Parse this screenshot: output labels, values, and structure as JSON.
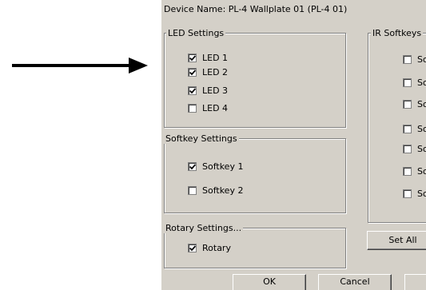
{
  "dialog": {
    "device_name": "Device Name: PL-4 Wallplate 01 (PL-4 01)"
  },
  "led_settings": {
    "legend": "LED Settings",
    "items": [
      {
        "label": "LED 1",
        "checked": true
      },
      {
        "label": "LED 2",
        "checked": true
      },
      {
        "label": "LED 3",
        "checked": true
      },
      {
        "label": "LED 4",
        "checked": false
      }
    ]
  },
  "softkey_settings": {
    "legend": "Softkey Settings",
    "items": [
      {
        "label": "Softkey 1",
        "checked": true
      },
      {
        "label": "Softkey 2",
        "checked": false
      }
    ]
  },
  "rotary_settings": {
    "legend": "Rotary Settings...",
    "items": [
      {
        "label": "Rotary",
        "checked": true
      }
    ]
  },
  "ir_softkeys": {
    "legend": "IR Softkeys",
    "items": [
      {
        "label": "So",
        "checked": false
      },
      {
        "label": "So",
        "checked": false
      },
      {
        "label": "So",
        "checked": false
      },
      {
        "label": "So",
        "checked": false
      },
      {
        "label": "So",
        "checked": false
      },
      {
        "label": "So",
        "checked": false
      },
      {
        "label": "So",
        "checked": false
      }
    ]
  },
  "buttons": {
    "set_all": "Set All",
    "ok": "OK",
    "cancel": "Cancel"
  },
  "icons": {
    "arrow": "arrow-right-icon",
    "check": "checkmark-icon"
  }
}
